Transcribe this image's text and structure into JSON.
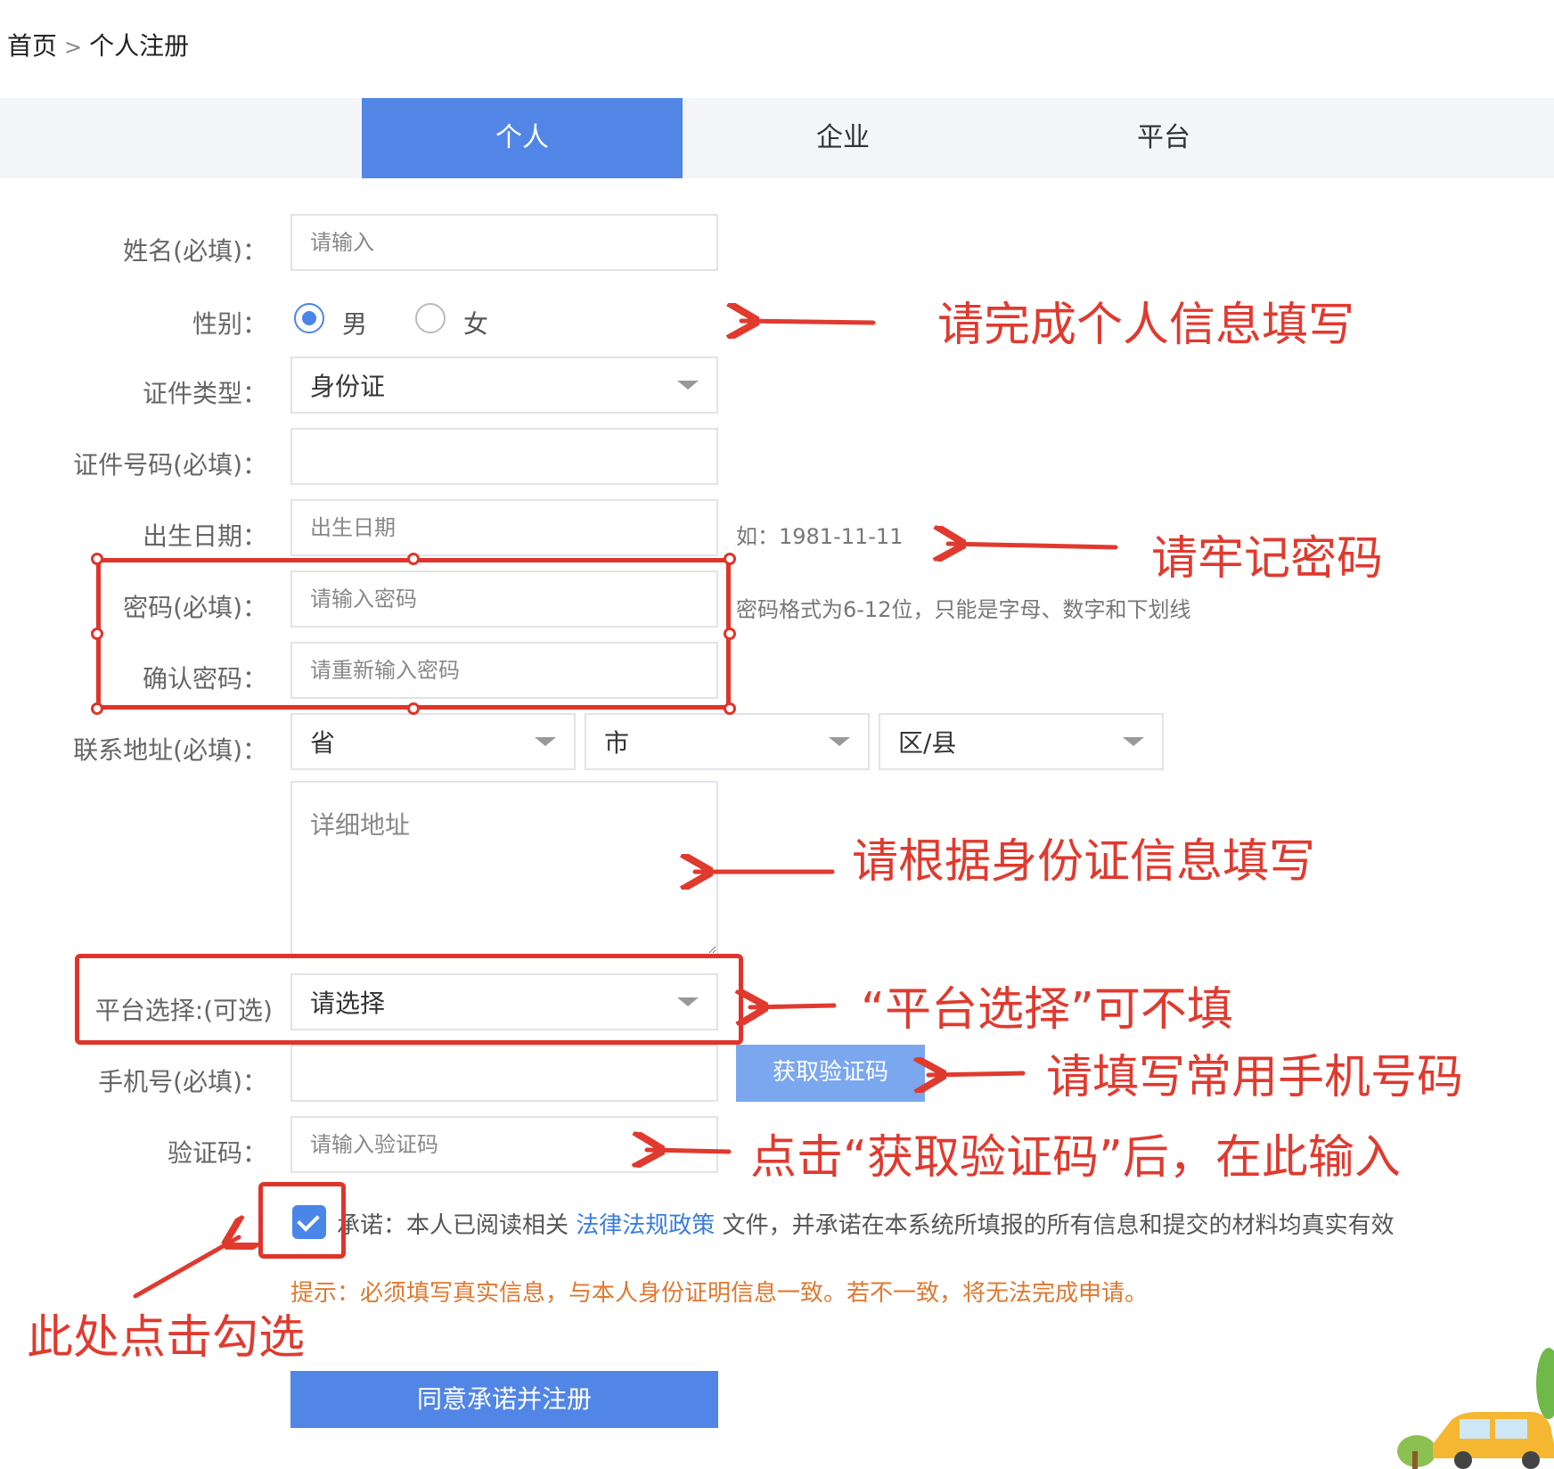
{
  "breadcrumb": {
    "home": "首页",
    "separator": ">",
    "current": "个人注册"
  },
  "tabs": [
    {
      "label": "个人",
      "active": true
    },
    {
      "label": "企业",
      "active": false
    },
    {
      "label": "平台",
      "active": false
    }
  ],
  "form": {
    "name": {
      "label": "姓名(必填)：",
      "placeholder": "请输入"
    },
    "gender": {
      "label": "性别：",
      "options": [
        "男",
        "女"
      ],
      "selected": "男"
    },
    "id_type": {
      "label": "证件类型：",
      "value": "身份证"
    },
    "id_number": {
      "label": "证件号码(必填)：",
      "placeholder": ""
    },
    "birth": {
      "label": "出生日期：",
      "placeholder": "出生日期",
      "hint": "如：1981-11-11"
    },
    "password": {
      "label": "密码(必填)：",
      "placeholder": "请输入密码",
      "hint": "密码格式为6-12位，只能是字母、数字和下划线"
    },
    "confirm_password": {
      "label": "确认密码：",
      "placeholder": "请重新输入密码"
    },
    "address": {
      "label": "联系地址(必填)：",
      "province": "省",
      "city": "市",
      "district": "区/县",
      "detail_placeholder": "详细地址"
    },
    "platform": {
      "label": "平台选择:(可选)",
      "value": "请选择"
    },
    "phone": {
      "label": "手机号(必填)：",
      "placeholder": "",
      "get_code_button": "获取验证码"
    },
    "code": {
      "label": "验证码：",
      "placeholder": "请输入验证码"
    },
    "agreement": {
      "checked": true,
      "prefix": "承诺：本人已阅读相关",
      "link": "法律法规政策",
      "suffix": "文件，并承诺在本系统所填报的所有信息和提交的材料均真实有效"
    },
    "tip": "提示：必须填写真实信息，与本人身份证明信息一致。若不一致，将无法完成申请。",
    "submit_button": "同意承诺并注册"
  },
  "annotations": {
    "personal_info": "请完成个人信息填写",
    "remember_password": "请牢记密码",
    "fill_by_id": "请根据身份证信息填写",
    "platform_optional": "“平台选择”可不填",
    "phone_hint": "请填写常用手机号码",
    "code_hint": "点击“获取验证码”后，在此输入",
    "check_here": "此处点击勾选"
  },
  "colors": {
    "accent": "#5286e6",
    "annotation": "#e03a2f",
    "tip": "#e0782f",
    "link": "#3a7ce0"
  }
}
